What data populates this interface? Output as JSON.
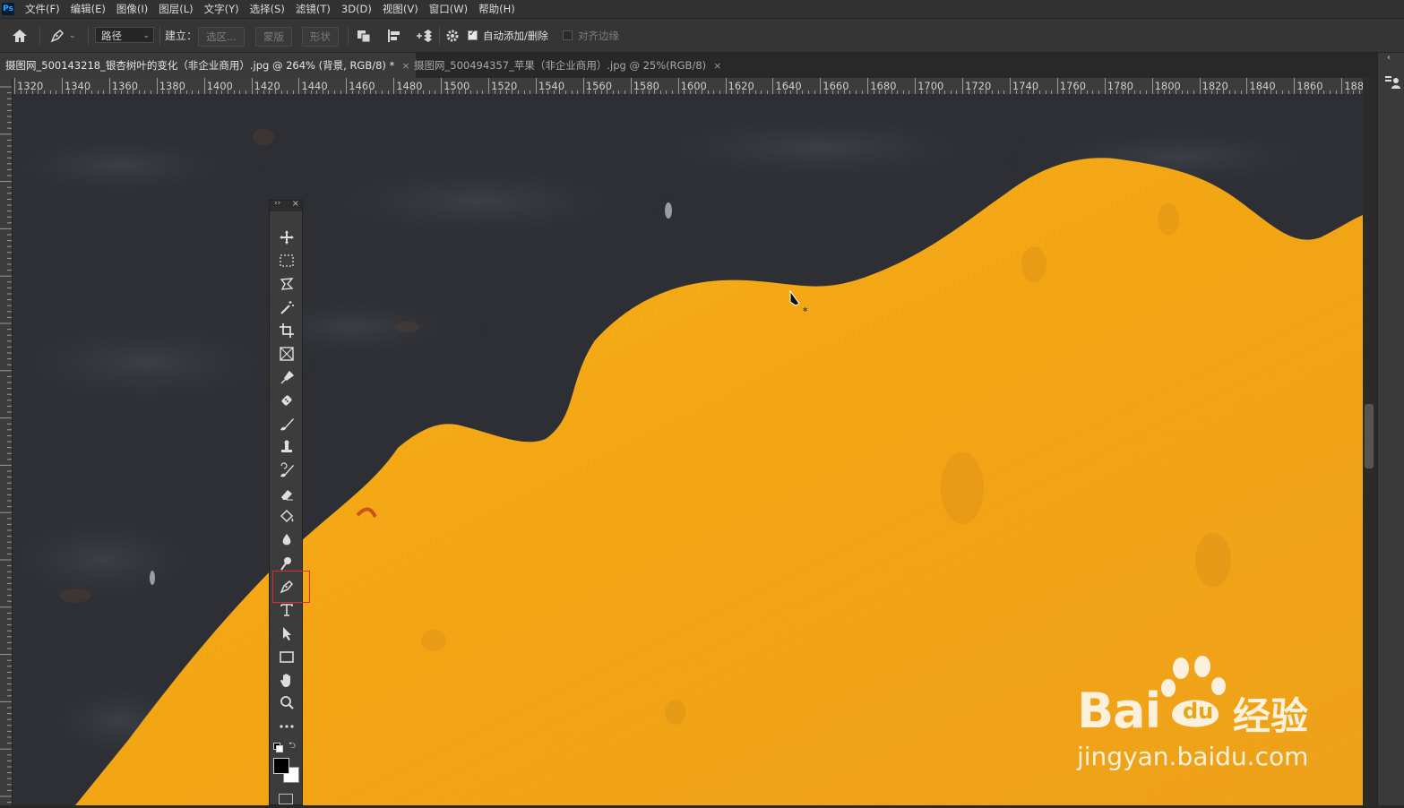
{
  "menubar": {
    "logo": "Ps",
    "items": [
      "文件(F)",
      "编辑(E)",
      "图像(I)",
      "图层(L)",
      "文字(Y)",
      "选择(S)",
      "滤镜(T)",
      "3D(D)",
      "视图(V)",
      "窗口(W)",
      "帮助(H)"
    ]
  },
  "options": {
    "mode_value": "路径",
    "make_label": "建立：",
    "selection_btn": "选区...",
    "mask_btn": "蒙版",
    "shape_btn": "形状",
    "auto_add_delete_label": "自动添加/删除",
    "auto_add_delete_checked": true,
    "align_edges_label": "对齐边缘",
    "align_edges_checked": false
  },
  "tabs": [
    {
      "label": "摄图网_500143218_银杏树叶的变化（非企业商用）.jpg @ 264% (背景, RGB/8) *",
      "close": "×",
      "active": true
    },
    {
      "label": "摄图网_500494357_苹果（非企业商用）.jpg @ 25%(RGB/8)",
      "close": "×",
      "active": false
    }
  ],
  "ruler": {
    "labels": [
      "1320",
      "1340",
      "1360",
      "1380",
      "1400",
      "1420",
      "1440",
      "1460",
      "1480",
      "1500",
      "1520",
      "1540",
      "1560",
      "1580",
      "1600",
      "1620",
      "1640",
      "1660",
      "1680",
      "1700",
      "1720",
      "1740",
      "1760",
      "1780",
      "1800",
      "1820",
      "1840",
      "1860",
      "188"
    ]
  },
  "tools": [
    {
      "name": "move-tool-icon"
    },
    {
      "name": "marquee-tool-icon"
    },
    {
      "name": "lasso-tool-icon"
    },
    {
      "name": "magic-wand-tool-icon"
    },
    {
      "name": "crop-tool-icon"
    },
    {
      "name": "frame-tool-icon"
    },
    {
      "name": "eyedropper-tool-icon"
    },
    {
      "name": "healing-brush-tool-icon"
    },
    {
      "name": "brush-tool-icon"
    },
    {
      "name": "clone-stamp-tool-icon"
    },
    {
      "name": "history-brush-tool-icon"
    },
    {
      "name": "eraser-tool-icon"
    },
    {
      "name": "paint-bucket-tool-icon"
    },
    {
      "name": "blur-tool-icon"
    },
    {
      "name": "dodge-tool-icon"
    },
    {
      "name": "pen-tool-icon",
      "selected": true
    },
    {
      "name": "type-tool-icon"
    },
    {
      "name": "path-selection-tool-icon"
    },
    {
      "name": "rectangle-tool-icon"
    },
    {
      "name": "hand-tool-icon"
    },
    {
      "name": "zoom-tool-icon"
    },
    {
      "name": "more-tools-icon"
    }
  ],
  "colors": {
    "foreground": "#000000",
    "background": "#ffffff",
    "leaf": "#f2a516",
    "bark": "#2c2e33",
    "selected_outline": "#e02b2b"
  },
  "watermark": {
    "brand": "Bai",
    "brand_suffix": "经验",
    "du": "du",
    "url": "jingyan.baidu.com"
  }
}
